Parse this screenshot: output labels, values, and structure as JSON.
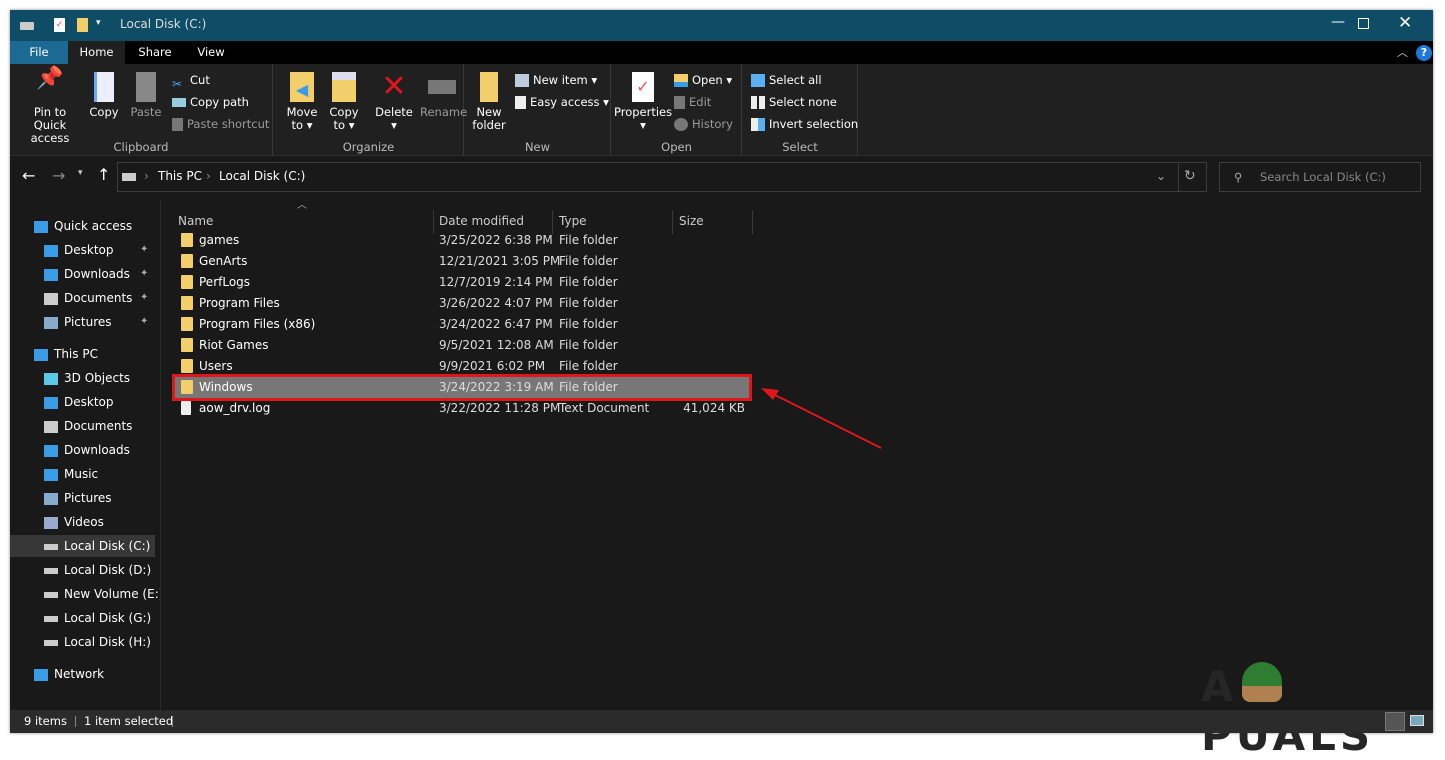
{
  "window": {
    "title": "Local Disk (C:)"
  },
  "tabs": [
    "File",
    "Home",
    "Share",
    "View"
  ],
  "ribbon": {
    "clipboard": {
      "label": "Clipboard",
      "pin": "Pin to Quick",
      "pin2": "access",
      "copy": "Copy",
      "paste": "Paste",
      "cut": "Cut",
      "copy_path": "Copy path",
      "paste_shortcut": "Paste shortcut"
    },
    "organize": {
      "label": "Organize",
      "move": "Move",
      "move2": "to",
      "copy": "Copy",
      "copy2": "to",
      "delete": "Delete",
      "rename": "Rename"
    },
    "new": {
      "label": "New",
      "new_folder": "New",
      "new_folder2": "folder",
      "new_item": "New item",
      "easy_access": "Easy access"
    },
    "open": {
      "label": "Open",
      "properties": "Properties",
      "open": "Open",
      "edit": "Edit",
      "history": "History"
    },
    "select": {
      "label": "Select",
      "all": "Select all",
      "none": "Select none",
      "invert": "Invert selection"
    }
  },
  "nav": {
    "breadcrumb": [
      "This PC",
      "Local Disk (C:)"
    ],
    "search_placeholder": "Search Local Disk (C:)"
  },
  "sidebar": [
    {
      "label": "Quick access",
      "type": "star",
      "indent": 0
    },
    {
      "label": "Desktop",
      "type": "desktop",
      "indent": 1,
      "pinned": true
    },
    {
      "label": "Downloads",
      "type": "down",
      "indent": 1,
      "pinned": true
    },
    {
      "label": "Documents",
      "type": "doc",
      "indent": 1,
      "pinned": true
    },
    {
      "label": "Pictures",
      "type": "pic",
      "indent": 1,
      "pinned": true
    },
    {
      "label": "This PC",
      "type": "pc",
      "indent": 0,
      "gap": true
    },
    {
      "label": "3D Objects",
      "type": "cube",
      "indent": 1
    },
    {
      "label": "Desktop",
      "type": "desktop",
      "indent": 1
    },
    {
      "label": "Documents",
      "type": "doc",
      "indent": 1
    },
    {
      "label": "Downloads",
      "type": "down",
      "indent": 1
    },
    {
      "label": "Music",
      "type": "music",
      "indent": 1
    },
    {
      "label": "Pictures",
      "type": "pic",
      "indent": 1
    },
    {
      "label": "Videos",
      "type": "video",
      "indent": 1
    },
    {
      "label": "Local Disk (C:)",
      "type": "drive",
      "indent": 1,
      "selected": true
    },
    {
      "label": "Local Disk (D:)",
      "type": "drive",
      "indent": 1
    },
    {
      "label": "New Volume (E:)",
      "type": "drive",
      "indent": 1
    },
    {
      "label": "Local Disk (G:)",
      "type": "drive",
      "indent": 1
    },
    {
      "label": "Local Disk (H:)",
      "type": "drive",
      "indent": 1
    },
    {
      "label": "Network",
      "type": "net",
      "indent": 0,
      "gap": true
    }
  ],
  "columns": [
    "Name",
    "Date modified",
    "Type",
    "Size"
  ],
  "files": [
    {
      "name": "games",
      "date": "3/25/2022 6:38 PM",
      "type": "File folder",
      "size": ""
    },
    {
      "name": "GenArts",
      "date": "12/21/2021 3:05 PM",
      "type": "File folder",
      "size": ""
    },
    {
      "name": "PerfLogs",
      "date": "12/7/2019 2:14 PM",
      "type": "File folder",
      "size": ""
    },
    {
      "name": "Program Files",
      "date": "3/26/2022 4:07 PM",
      "type": "File folder",
      "size": ""
    },
    {
      "name": "Program Files (x86)",
      "date": "3/24/2022 6:47 PM",
      "type": "File folder",
      "size": ""
    },
    {
      "name": "Riot Games",
      "date": "9/5/2021 12:08 AM",
      "type": "File folder",
      "size": ""
    },
    {
      "name": "Users",
      "date": "9/9/2021 6:02 PM",
      "type": "File folder",
      "size": ""
    },
    {
      "name": "Windows",
      "date": "3/24/2022 3:19 AM",
      "type": "File folder",
      "size": "",
      "selected": true
    },
    {
      "name": "aow_drv.log",
      "date": "3/22/2022 11:28 PM",
      "type": "Text Document",
      "size": "41,024 KB",
      "file": true
    }
  ],
  "status": {
    "items": "9 items",
    "selected": "1 item selected"
  },
  "watermark": "APPUALS",
  "colors": {
    "titlebar": "#0f4c66",
    "highlight": "#777777",
    "annotation": "#e0161b",
    "file_tab": "#1c6a94"
  }
}
